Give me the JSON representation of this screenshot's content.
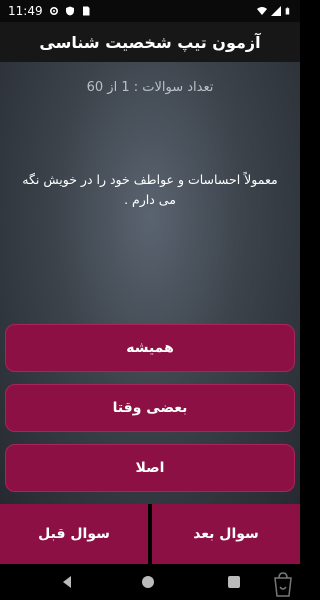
{
  "status_bar": {
    "time": "11:49",
    "icons": [
      "gear-icon",
      "shield-icon",
      "sim-icon",
      "wifi-icon",
      "signal-icon",
      "battery-icon"
    ]
  },
  "app_bar": {
    "title": "آزمون تیپ شخصیت شناسی"
  },
  "quiz": {
    "counter": "تعداد سوالات : 1 از 60",
    "question": "معمولاً احساسات و عواطف خود را در خویش نگه می دارم ."
  },
  "answers": [
    {
      "label": "همیشه"
    },
    {
      "label": "بعضی وقتا"
    },
    {
      "label": "اصلا"
    }
  ],
  "navigation": {
    "prev_label": "سوال قبل",
    "next_label": "سوال بعد"
  },
  "colors": {
    "accent": "#8d1045",
    "app_bar": "#171717",
    "background": "#3c434b"
  }
}
